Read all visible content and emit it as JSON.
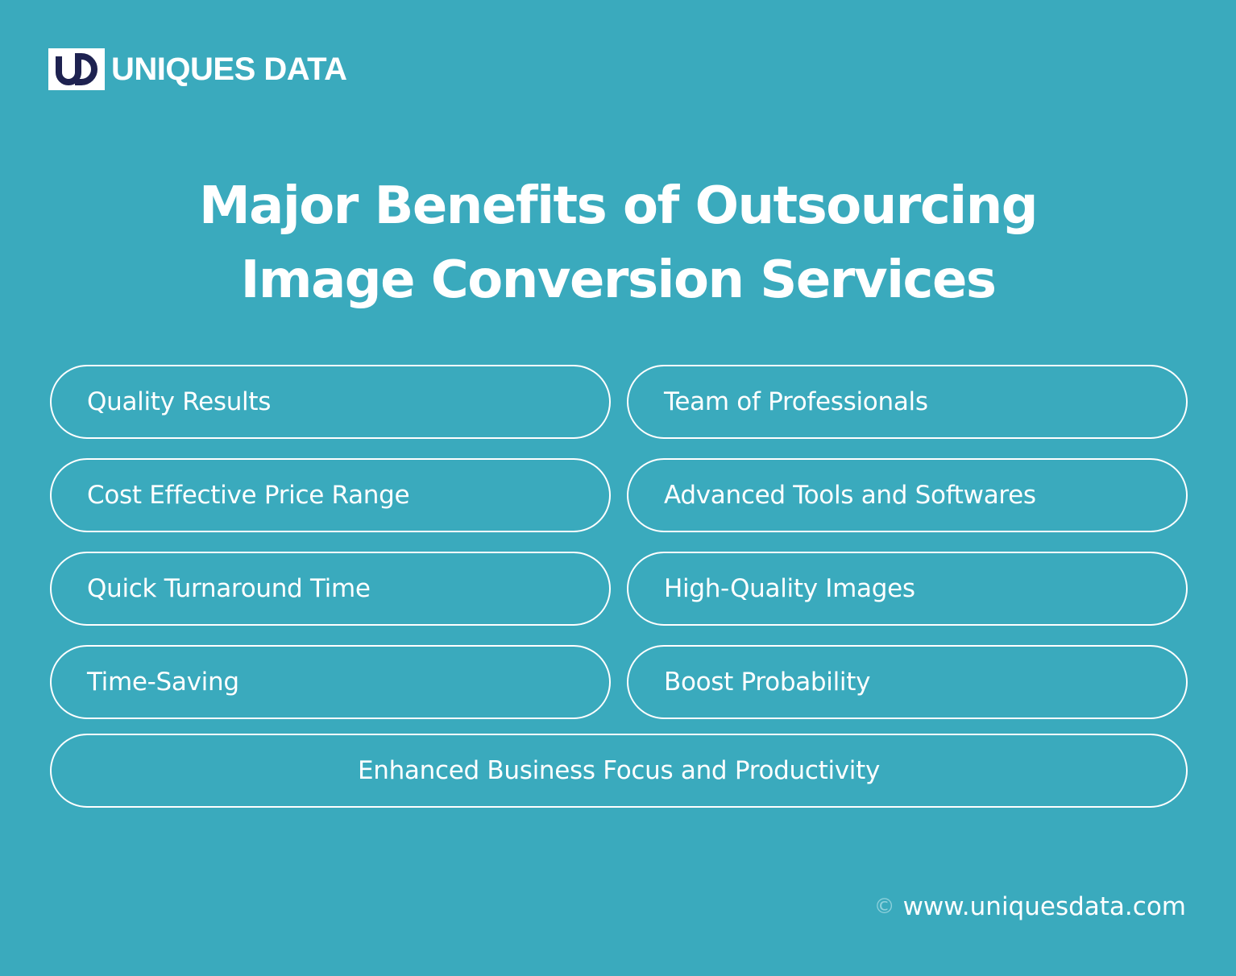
{
  "logo": {
    "mark": "UD",
    "text": "UNIQUES DATA"
  },
  "title": {
    "line1": "Major Benefits of Outsourcing",
    "line2": "Image Conversion Services"
  },
  "benefits": [
    "Quality Results",
    "Team of Professionals",
    "Cost Effective Price Range",
    "Advanced Tools and Softwares",
    "Quick Turnaround Time",
    "High-Quality Images",
    "Time-Saving",
    "Boost Probability",
    "Enhanced Business Focus and Productivity"
  ],
  "footer": {
    "icon": "copyright-icon",
    "url": "www.uniquesdata.com"
  },
  "colors": {
    "background": "#3aaabd",
    "logo_mark": "#1e2250"
  }
}
